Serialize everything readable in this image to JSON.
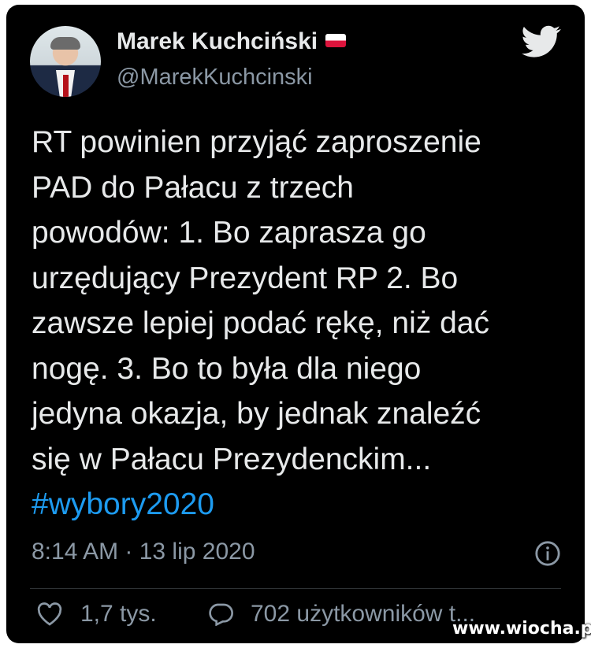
{
  "tweet": {
    "author": {
      "name": "Marek Kuchciński",
      "handle": "@MarekKuchcinski",
      "avatar_icon": "profile-photo",
      "flag_icon": "poland-flag-icon"
    },
    "text_lines": [
      "RT powinien przyjąć zaproszenie",
      "PAD do Pałacu z trzech",
      "powodów: 1. Bo zaprasza go",
      "urzędujący Prezydent RP 2. Bo",
      "zawsze lepiej podać rękę, niż dać",
      "nogę. 3. Bo to była dla niego",
      "jedyna okazja, by jednak znaleźć",
      "się w Pałacu Prezydenckim..."
    ],
    "hashtag": "#wybory2020",
    "timestamp": "8:14 AM · 13 lip 2020",
    "likes": "1,7 tys.",
    "replies": "702 użytkowników t..."
  },
  "watermark": "www.wiocha.pl",
  "colors": {
    "background": "#000000",
    "text": "#e7e9ea",
    "secondary": "#8b98a5",
    "accent": "#1d9bf0"
  },
  "icons": {
    "brand": "twitter-bird-icon",
    "info": "info-icon",
    "like": "heart-icon",
    "reply": "speech-bubble-icon"
  }
}
